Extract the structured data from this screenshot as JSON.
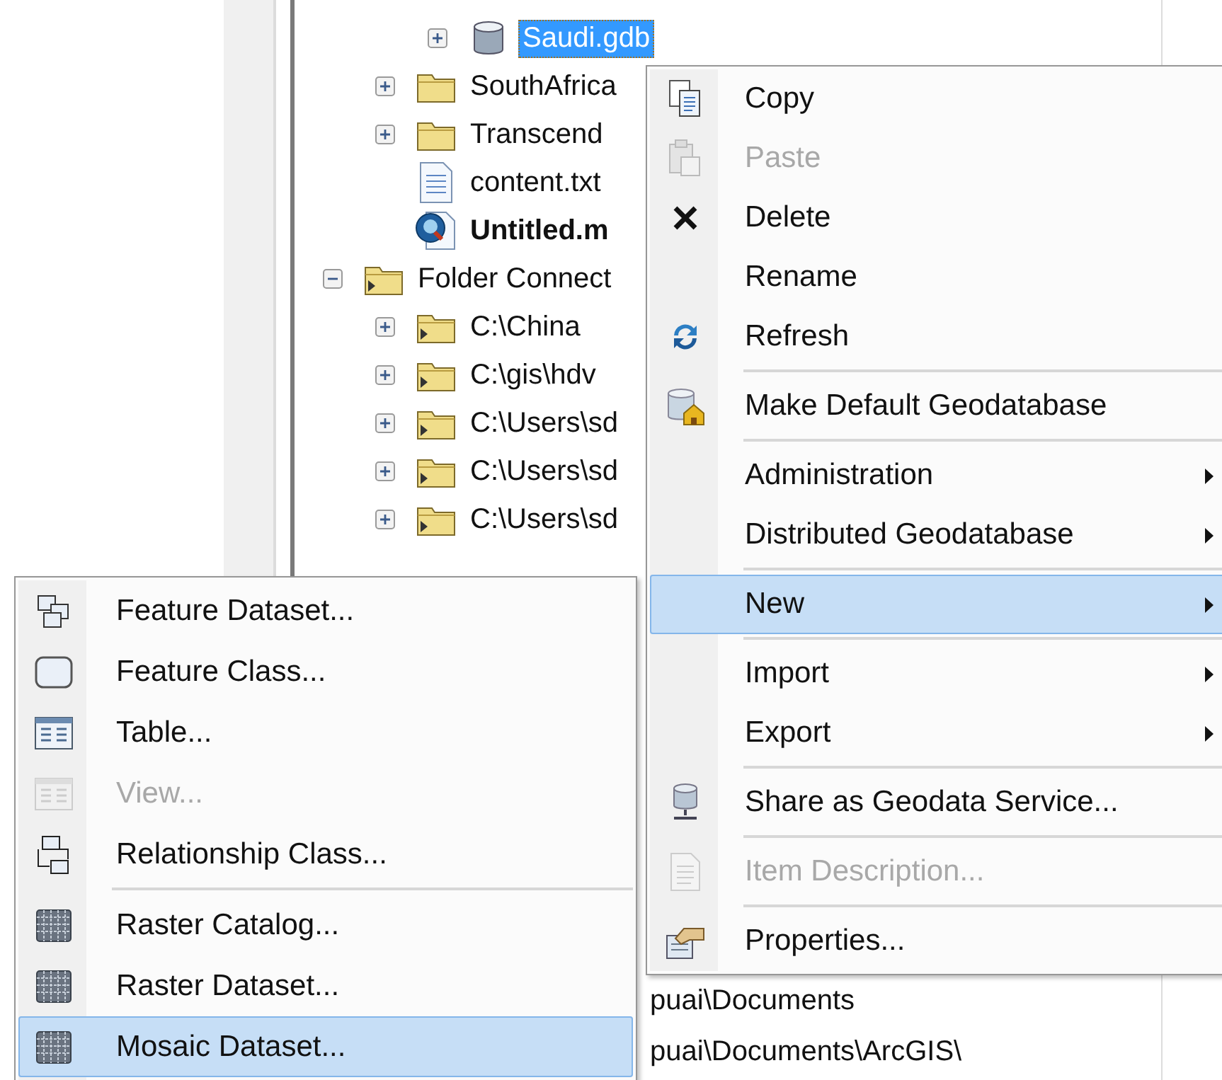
{
  "tree": {
    "items": [
      {
        "children": [
          {
            "children": [
              {
                "label": "Saudi.gdb",
                "kind": "geodatabase",
                "expanded": false,
                "selected": true,
                "bold": false
              }
            ]
          },
          {
            "label": "SouthAfrica",
            "kind": "folder",
            "expanded": false,
            "selected": false,
            "bold": false
          },
          {
            "label": "Transcend",
            "kind": "folder",
            "expanded": false,
            "selected": false,
            "bold": false
          },
          {
            "label": "content.txt",
            "kind": "text-file",
            "selected": false,
            "bold": false
          },
          {
            "label": "Untitled.m",
            "kind": "map-document",
            "selected": false,
            "bold": true
          }
        ]
      },
      {
        "label": "Folder Connect",
        "kind": "folder-connections",
        "expanded": true,
        "selected": false,
        "bold": false,
        "children": [
          {
            "label": "C:\\China",
            "kind": "folder-connection",
            "expanded": false,
            "selected": false,
            "bold": false
          },
          {
            "label": "C:\\gis\\hdv",
            "kind": "folder-connection",
            "expanded": false,
            "selected": false,
            "bold": false
          },
          {
            "label": "C:\\Users\\sd",
            "kind": "folder-connection",
            "expanded": false,
            "selected": false,
            "bold": false
          },
          {
            "label": "C:\\Users\\sd",
            "kind": "folder-connection",
            "expanded": false,
            "selected": false,
            "bold": false
          },
          {
            "label": "C:\\Users\\sd",
            "kind": "folder-connection",
            "expanded": false,
            "selected": false,
            "bold": false
          }
        ]
      }
    ],
    "lower_items": [
      {
        "label": "puai\\Documents"
      },
      {
        "label": "puai\\Documents\\ArcGIS\\"
      }
    ]
  },
  "context_menu": {
    "items": [
      {
        "kind": "item",
        "label": "Copy",
        "disabled": false,
        "selected": false,
        "submenu": false
      },
      {
        "kind": "item",
        "label": "Paste",
        "disabled": true,
        "selected": false,
        "submenu": false
      },
      {
        "kind": "item",
        "label": "Delete",
        "disabled": false,
        "selected": false,
        "submenu": false
      },
      {
        "kind": "item",
        "label": "Rename",
        "disabled": false,
        "selected": false,
        "submenu": false
      },
      {
        "kind": "item",
        "label": "Refresh",
        "disabled": false,
        "selected": false,
        "submenu": false
      },
      {
        "kind": "separator"
      },
      {
        "kind": "item",
        "label": "Make Default Geodatabase",
        "disabled": false,
        "selected": false,
        "submenu": false
      },
      {
        "kind": "separator"
      },
      {
        "kind": "item",
        "label": "Administration",
        "disabled": false,
        "selected": false,
        "submenu": true
      },
      {
        "kind": "item",
        "label": "Distributed Geodatabase",
        "disabled": false,
        "selected": false,
        "submenu": true
      },
      {
        "kind": "separator"
      },
      {
        "kind": "item",
        "label": "New",
        "disabled": false,
        "selected": true,
        "submenu": true
      },
      {
        "kind": "separator"
      },
      {
        "kind": "item",
        "label": "Import",
        "disabled": false,
        "selected": false,
        "submenu": true
      },
      {
        "kind": "item",
        "label": "Export",
        "disabled": false,
        "selected": false,
        "submenu": true
      },
      {
        "kind": "separator"
      },
      {
        "kind": "item",
        "label": "Share as Geodata Service...",
        "disabled": false,
        "selected": false,
        "submenu": false
      },
      {
        "kind": "separator"
      },
      {
        "kind": "item",
        "label": "Item Description...",
        "disabled": true,
        "selected": false,
        "submenu": false
      },
      {
        "kind": "separator"
      },
      {
        "kind": "item",
        "label": "Properties...",
        "disabled": false,
        "selected": false,
        "submenu": false
      }
    ]
  },
  "new_submenu": {
    "items": [
      {
        "kind": "item",
        "label": "Feature Dataset...",
        "disabled": false,
        "selected": false
      },
      {
        "kind": "item",
        "label": "Feature Class...",
        "disabled": false,
        "selected": false
      },
      {
        "kind": "item",
        "label": "Table...",
        "disabled": false,
        "selected": false
      },
      {
        "kind": "item",
        "label": "View...",
        "disabled": true,
        "selected": false
      },
      {
        "kind": "item",
        "label": "Relationship Class...",
        "disabled": false,
        "selected": false
      },
      {
        "kind": "separator"
      },
      {
        "kind": "item",
        "label": "Raster Catalog...",
        "disabled": false,
        "selected": false
      },
      {
        "kind": "item",
        "label": "Raster Dataset...",
        "disabled": false,
        "selected": false
      },
      {
        "kind": "item",
        "label": "Mosaic Dataset...",
        "disabled": false,
        "selected": true
      }
    ]
  }
}
